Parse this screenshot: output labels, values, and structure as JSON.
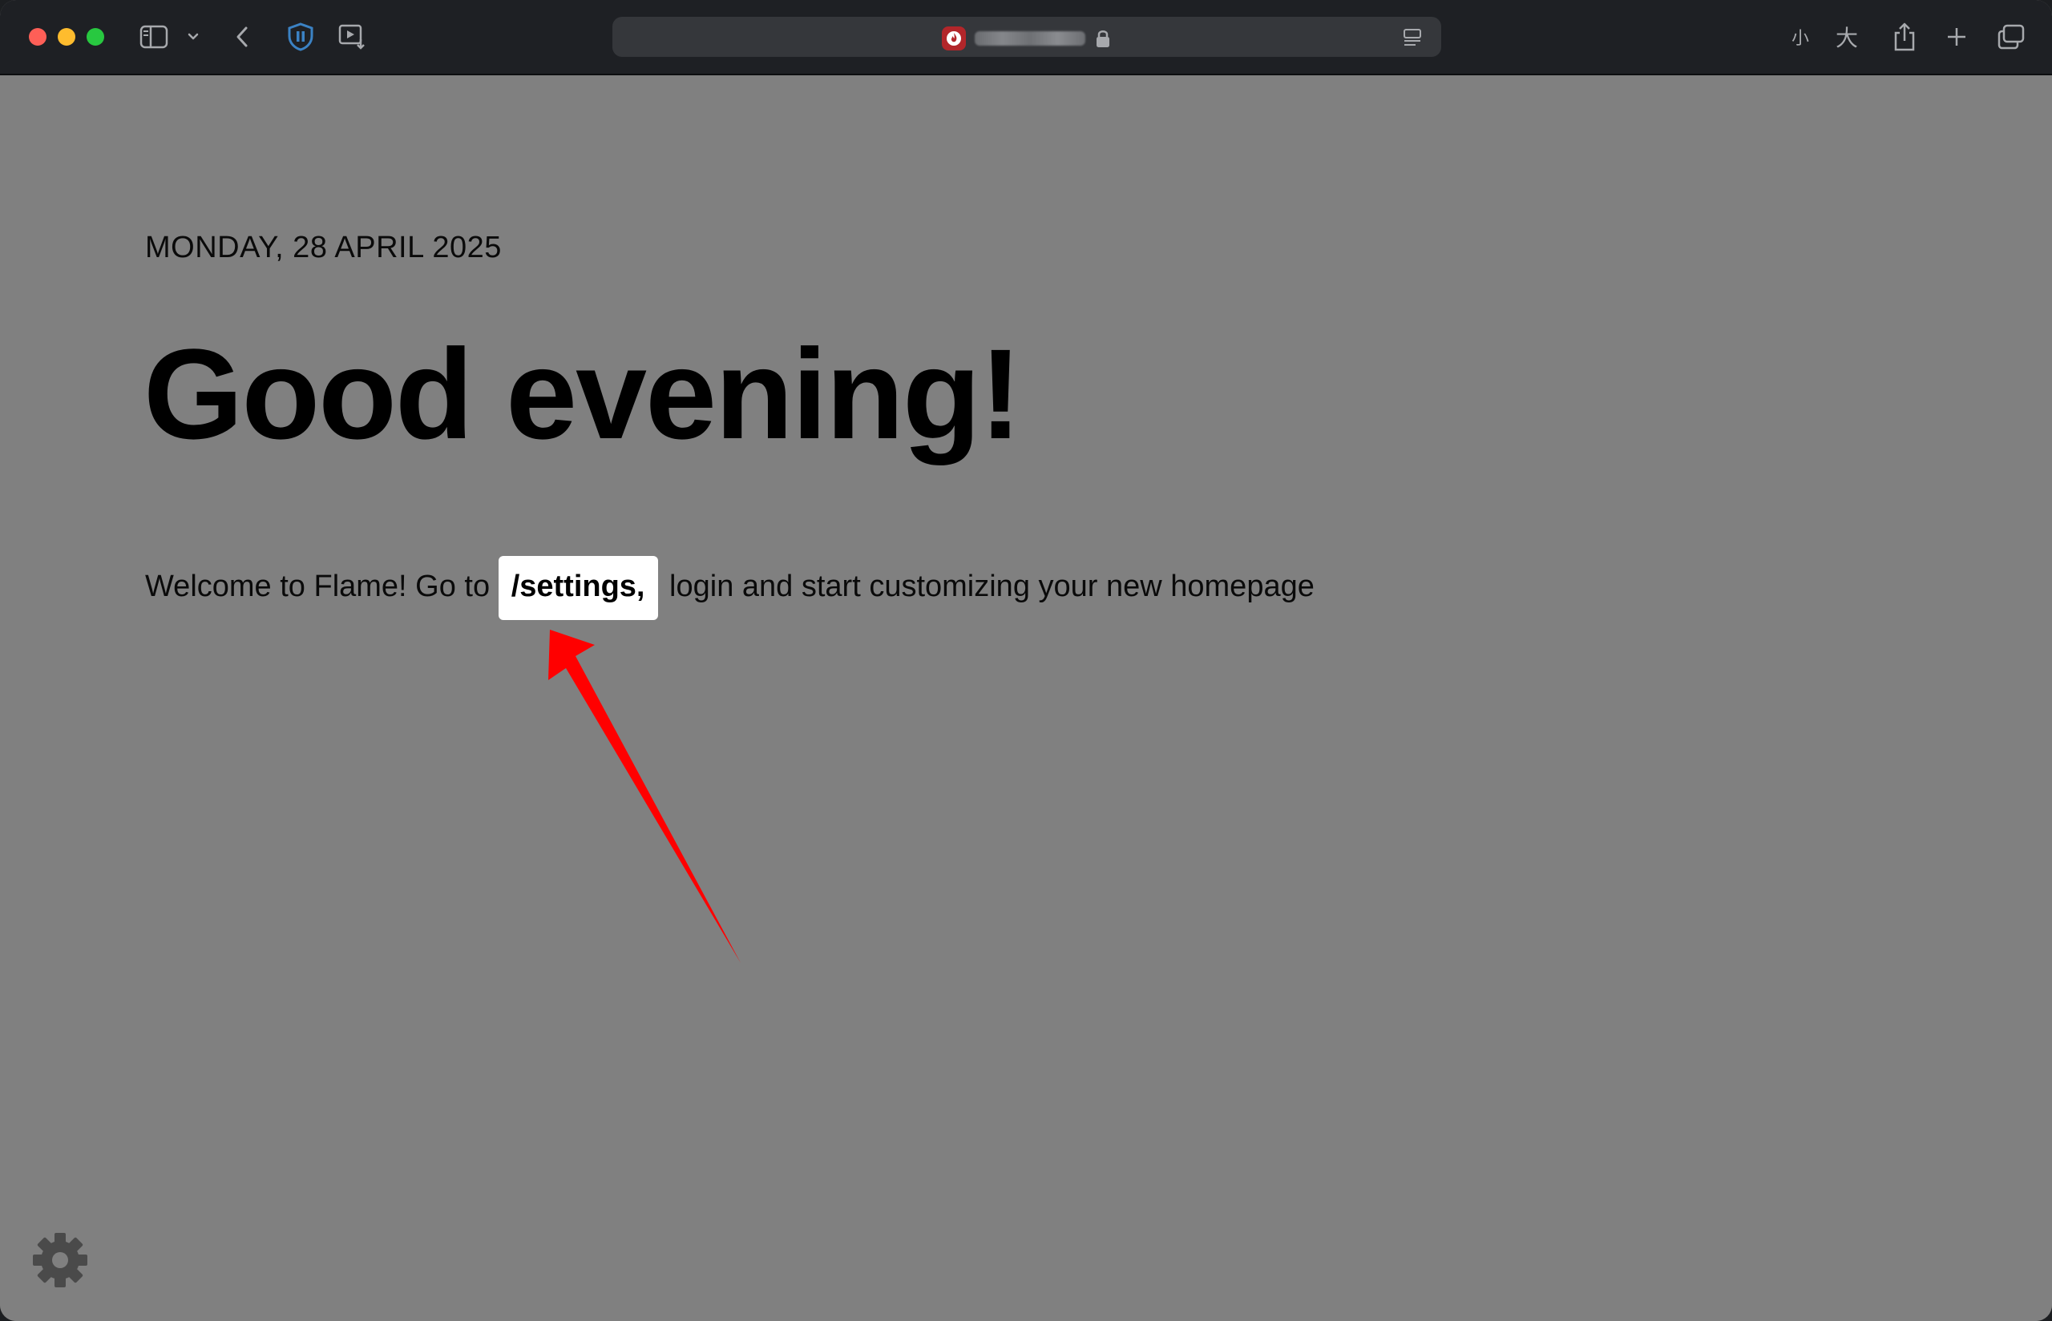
{
  "browser": {
    "window_buttons": [
      "close",
      "minimize",
      "maximize"
    ],
    "toolbar_icons": [
      "sidebar-icon",
      "chevron-down-icon",
      "back-icon",
      "shield-icon",
      "media-icon"
    ],
    "right_icons": [
      "translate-small-icon",
      "translate-large-icon",
      "share-icon",
      "new-tab-icon",
      "tab-overview-icon"
    ],
    "translate_small_label": "小",
    "translate_large_label": "大"
  },
  "page": {
    "date": "MONDAY, 28 APRIL 2025",
    "greeting": "Good evening!",
    "welcome_before": "Welcome to Flame! Go to ",
    "settings_link": "/settings,",
    "welcome_after": " login and start customizing your new homepage"
  },
  "annotation": {
    "arrow_color": "#ff0000"
  },
  "colors": {
    "page_background": "#808080",
    "toolbar_background": "#1e2024",
    "highlight_background": "#ffffff"
  }
}
